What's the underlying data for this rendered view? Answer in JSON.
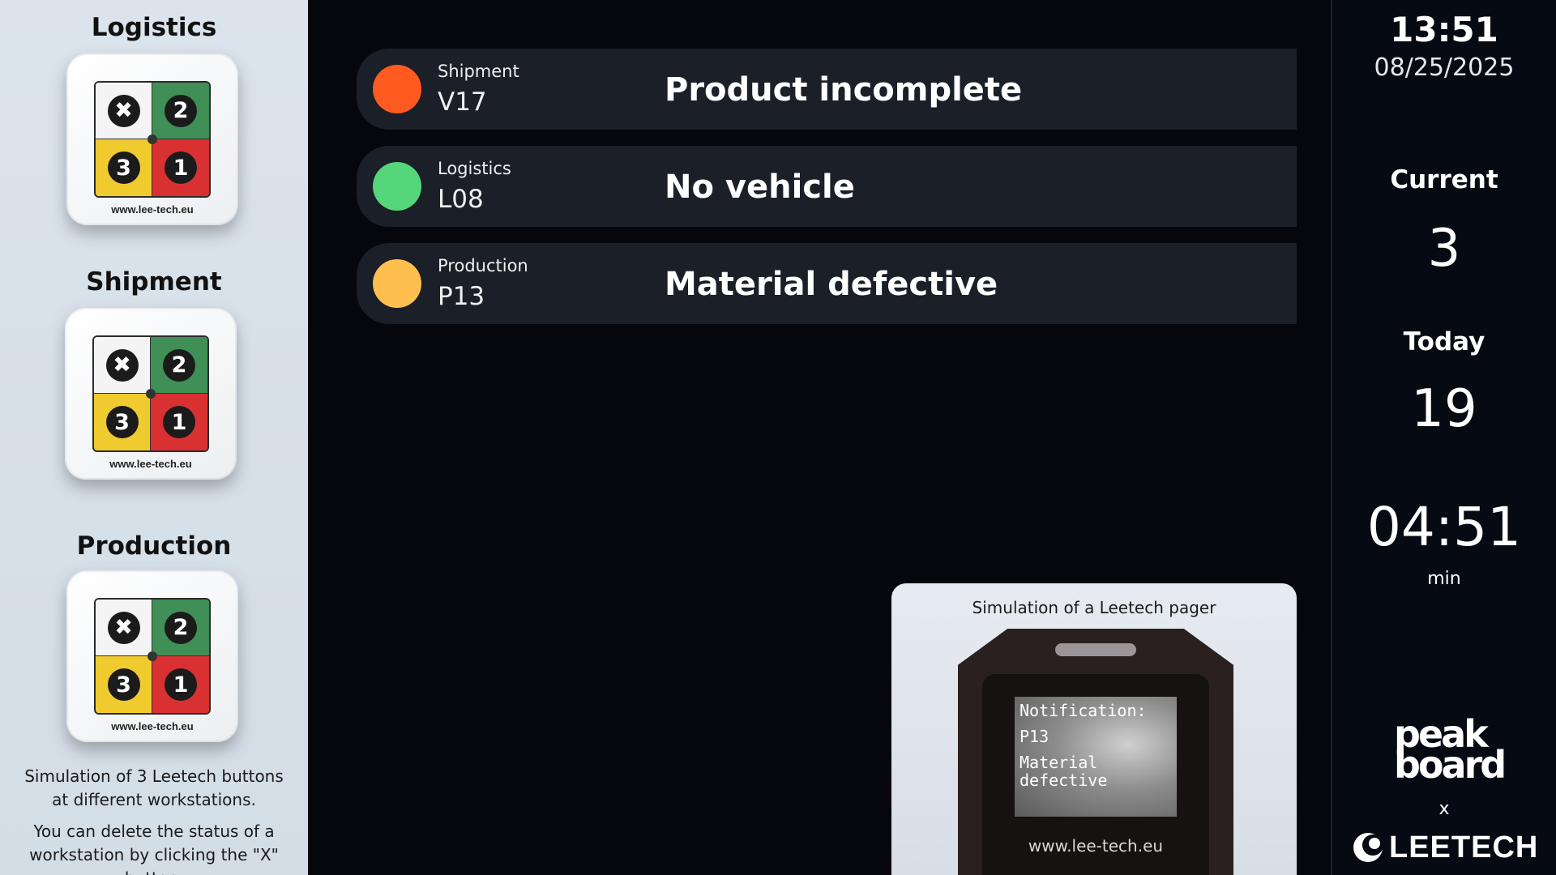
{
  "stations": [
    {
      "title": "Logistics",
      "device_url": "www.lee-tech.eu",
      "buttons": {
        "x": "✖",
        "b2": "2",
        "b3": "3",
        "b1": "1"
      }
    },
    {
      "title": "Shipment",
      "device_url": "www.lee-tech.eu",
      "buttons": {
        "x": "✖",
        "b2": "2",
        "b3": "3",
        "b1": "1"
      }
    },
    {
      "title": "Production",
      "device_url": "www.lee-tech.eu",
      "buttons": {
        "x": "✖",
        "b2": "2",
        "b3": "3",
        "b1": "1"
      }
    }
  ],
  "left_notes": {
    "simulation": "Simulation of 3 Leetech buttons at different workstations.",
    "delete_hint": "You can delete the status of a workstation by clicking the \"X\" button."
  },
  "status_rows": [
    {
      "station": "Shipment",
      "code": "V17",
      "message": "Product incomplete",
      "color": "#ff5a1f"
    },
    {
      "station": "Logistics",
      "code": "L08",
      "message": "No vehicle",
      "color": "#56d67a"
    },
    {
      "station": "Production",
      "code": "P13",
      "message": "Material defective",
      "color": "#ffbf4f"
    }
  ],
  "pager": {
    "caption": "Simulation of a Leetech pager",
    "screen_title": "Notification:",
    "screen_code": "P13",
    "screen_message": "Material defective",
    "url": "www.lee-tech.eu"
  },
  "sidebar": {
    "time": "13:51",
    "date": "08/25/2025",
    "current_label": "Current",
    "current_value": "3",
    "today_label": "Today",
    "today_value": "19",
    "duration_value": "04:51",
    "duration_unit": "min",
    "brand_line1": "peak",
    "brand_line2": "board",
    "x_separator": "x",
    "partner_brand": "LEETECH"
  },
  "colors": {
    "button_x": "#f4f4f4",
    "button_2": "#3f8f56",
    "button_3": "#f0cb2f",
    "button_1": "#d93131"
  }
}
